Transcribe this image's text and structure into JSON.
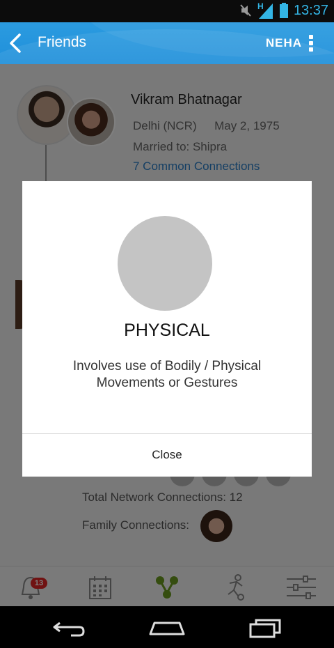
{
  "status_bar": {
    "time": "13:37",
    "network_label": "H"
  },
  "app_bar": {
    "title": "Friends",
    "user_name": "NEHA"
  },
  "profile": {
    "name": "Vikram Bhatnagar",
    "location": "Delhi (NCR)",
    "dob": "May 2, 1975",
    "married": "Married to: Shipra",
    "common": "7 Common Connections"
  },
  "network": {
    "total": "Total Network Connections: 12",
    "family": "Family Connections:"
  },
  "bottom_nav": {
    "notification_count": "13"
  },
  "dialog": {
    "title": "PHYSICAL",
    "description": "Involves use of Bodily / Physical Movements or Gestures",
    "close_label": "Close"
  },
  "colors": {
    "accent": "#1f8fda",
    "link": "#2a7ec8",
    "badge": "#e02424",
    "active_nav": "#6a9a1f"
  }
}
